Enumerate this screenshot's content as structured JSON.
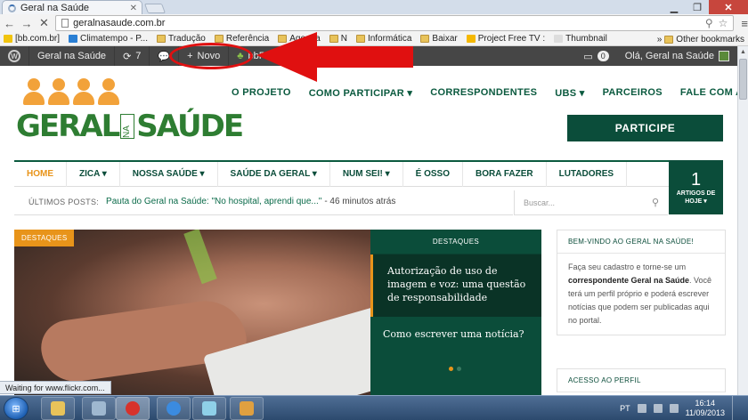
{
  "browser": {
    "tab_title": "Geral na Saúde",
    "url": "geralnasaude.com.br",
    "bookmarks": [
      {
        "label": "[bb.com.br]",
        "icon": "bb-favicon",
        "color": "#f1c40f"
      },
      {
        "label": "Climatempo - P...",
        "icon": "climatempo-favicon",
        "color": "#2a7fd4"
      },
      {
        "label": "Tradução",
        "icon": "folder-icon",
        "color": "#e8c35a"
      },
      {
        "label": "Referência",
        "icon": "folder-icon",
        "color": "#e8c35a"
      },
      {
        "label": "Agenda",
        "icon": "folder-icon",
        "color": "#e8c35a"
      },
      {
        "label": "N",
        "icon": "folder-icon",
        "color": "#e8c35a"
      },
      {
        "label": "Informática",
        "icon": "folder-icon",
        "color": "#e8c35a"
      },
      {
        "label": "Baixar",
        "icon": "folder-icon",
        "color": "#e8c35a"
      },
      {
        "label": "Project Free TV :",
        "icon": "projectfreetv-favicon",
        "color": "#f5b800"
      },
      {
        "label": "Thumbnail",
        "icon": "page-icon",
        "color": "#dddddd"
      }
    ],
    "other_bookmarks": "Other bookmarks",
    "status_text": "Waiting for www.flickr.com..."
  },
  "adminbar": {
    "site_name": "Geral na Saúde",
    "updates_count": "7",
    "new_label": "Novo",
    "plugin_label": "bbPress",
    "notifications_count": "0",
    "greeting": "Olá, Geral na Saúde"
  },
  "site": {
    "logo": {
      "word1": "GERAL",
      "word_na": "NA",
      "word2": "SAÚDE"
    },
    "main_nav": [
      {
        "label": "O PROJETO"
      },
      {
        "label": "COMO PARTICIPAR ▾"
      },
      {
        "label": "CORRESPONDENTES"
      },
      {
        "label": "UBS ▾"
      },
      {
        "label": "PARCEIROS"
      },
      {
        "label": "FALE COM A GENTE"
      }
    ],
    "participe_button": "PARTICIPE",
    "categories": [
      {
        "label": "HOME"
      },
      {
        "label": "ZICA ▾"
      },
      {
        "label": "NOSSA SAÚDE ▾"
      },
      {
        "label": "SAÚDE DA GERAL ▾"
      },
      {
        "label": "NUM SEI! ▾"
      },
      {
        "label": "É OSSO"
      },
      {
        "label": "BORA FAZER"
      },
      {
        "label": "LUTADORES"
      }
    ],
    "articles_today": {
      "count": "1",
      "label": "ARTIGOS DE HOJE ▾"
    },
    "ticker": {
      "label": "ÚLTIMOS POSTS:",
      "link": "Pauta do Geral na Saúde: \"No hospital, aprendi que...\"",
      "time": "- 46 minutos atrás"
    },
    "search_placeholder": "Buscar...",
    "hero_badge": "DESTAQUES",
    "featured": {
      "header": "DESTAQUES",
      "active_title": "Autorização de uso de imagem e voz: uma questão de responsabilidade",
      "second_title": "Como escrever uma notícia?"
    },
    "sidebar": {
      "welcome_title": "BEM-VINDO AO GERAL NA SAÚDE!",
      "welcome_pre": "Faça seu cadastro e torne-se um",
      "welcome_bold": "correspondente Geral na Saúde",
      "welcome_post": ". Você terá um perfil próprio e poderá escrever notícias que podem ser publicadas aqui no portal.",
      "profile_title": "ACESSO AO PERFIL"
    }
  },
  "taskbar": {
    "language": "PT",
    "time": "16:14",
    "date": "11/09/2013",
    "apps": [
      {
        "name": "explorer",
        "color": "#e8c35a"
      },
      {
        "name": "calculator",
        "color": "#9fb8d0"
      },
      {
        "name": "chrome",
        "color": "#d7322b"
      },
      {
        "name": "itunes",
        "color": "#3b8be0"
      },
      {
        "name": "notepad",
        "color": "#8fd0e8"
      },
      {
        "name": "paint",
        "color": "#e0a040"
      }
    ]
  },
  "colors": {
    "brand_green": "#0b4d3a",
    "accent_orange": "#e8941a",
    "annotation_red": "#e01010",
    "adminbar": "#464646"
  }
}
